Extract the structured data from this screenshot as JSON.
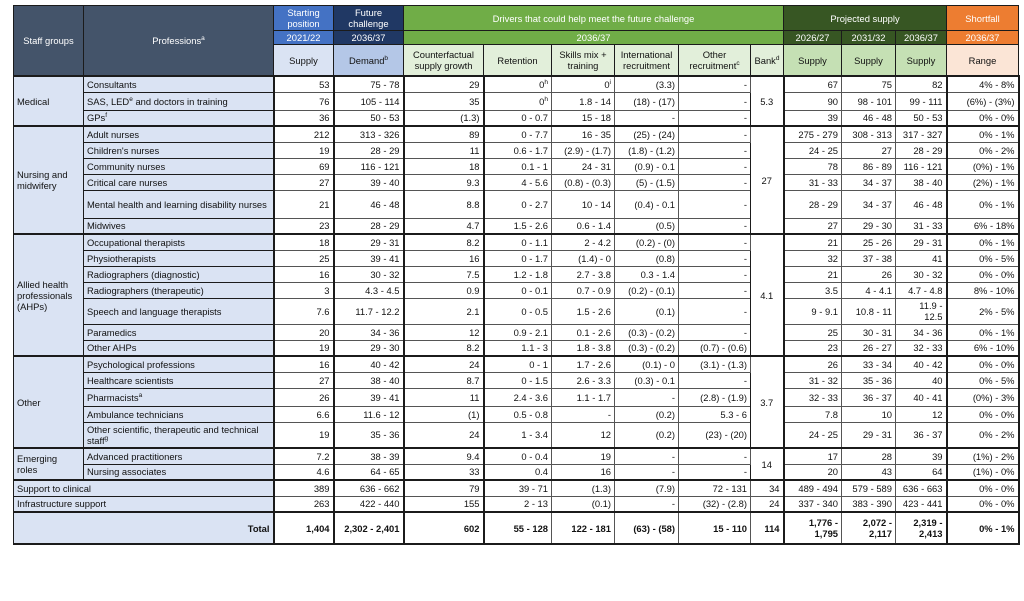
{
  "header": {
    "staff_groups": "Staff groups",
    "professions": "Professions",
    "professions_sup": "a",
    "starting_position": "Starting position",
    "future_challenge": "Future challenge",
    "drivers": "Drivers that could help meet the future challenge",
    "projected_supply": "Projected supply",
    "shortfall": "Shortfall",
    "year_start": "2021/22",
    "year_future": "2036/37",
    "year_drivers": "2036/37",
    "year_p1": "2026/27",
    "year_p2": "2031/32",
    "year_p3": "2036/37",
    "year_shortfall": "2036/37",
    "col_supply": "Supply",
    "col_demand": "Demand",
    "col_demand_sup": "b",
    "col_counterfactual": "Counterfactual supply growth",
    "col_retention": "Retention",
    "col_skills": "Skills mix + training",
    "col_international": "International recruitment",
    "col_other": "Other recruitment",
    "col_other_sup": "c",
    "col_bank": "Bank",
    "col_bank_sup": "d",
    "col_p_supply1": "Supply",
    "col_p_supply2": "Supply",
    "col_p_supply3": "Supply",
    "col_range": "Range"
  },
  "groups": {
    "medical": "Medical",
    "nursing": "Nursing and midwifery",
    "ahp": "Allied health professionals (AHPs)",
    "other": "Other",
    "emerging": "Emerging roles"
  },
  "banks": {
    "medical": "5.3",
    "nursing": "27",
    "ahp": "4.1",
    "other": "3.7",
    "emerging": "14"
  },
  "rows": [
    {
      "profession": "Consultants",
      "sup": "",
      "supply": "53",
      "demand": "75 - 78",
      "counterfactual": "29",
      "retention": "0",
      "retention_sup": "h",
      "skills": "0",
      "skills_sup": "i",
      "international": "(3.3)",
      "other": "-",
      "p1": "67",
      "p2": "75",
      "p3": "82",
      "range": "4% - 8%"
    },
    {
      "profession": "SAS, LED",
      "sup": "e",
      "profession_tail": " and doctors in training",
      "supply": "76",
      "demand": "105 - 114",
      "counterfactual": "35",
      "retention": "0",
      "retention_sup": "h",
      "skills": "1.8 - 14",
      "skills_sup": "",
      "international": "(18) - (17)",
      "other": "-",
      "p1": "90",
      "p2": "98 - 101",
      "p3": "99 - 111",
      "range": "(6%) - (3%)"
    },
    {
      "profession": "GPs",
      "sup": "f",
      "supply": "36",
      "demand": "50 - 53",
      "counterfactual": "(1.3)",
      "retention": "0 - 0.7",
      "retention_sup": "",
      "skills": "15 - 18",
      "skills_sup": "",
      "international": "-",
      "other": "-",
      "p1": "39",
      "p2": "46 - 48",
      "p3": "50 - 53",
      "range": "0% - 0%"
    },
    {
      "profession": "Adult nurses",
      "sup": "",
      "supply": "212",
      "demand": "313 - 326",
      "counterfactual": "89",
      "retention": "0 - 7.7",
      "retention_sup": "",
      "skills": "16 - 35",
      "skills_sup": "",
      "international": "(25) - (24)",
      "other": "-",
      "p1": "275 - 279",
      "p2": "308 - 313",
      "p3": "317 - 327",
      "range": "0% - 1%"
    },
    {
      "profession": "Children's nurses",
      "sup": "",
      "supply": "19",
      "demand": "28 - 29",
      "counterfactual": "11",
      "retention": "0.6 - 1.7",
      "retention_sup": "",
      "skills": "(2.9) - (1.7)",
      "skills_sup": "",
      "international": "(1.8) - (1.2)",
      "other": "-",
      "p1": "24 - 25",
      "p2": "27",
      "p3": "28 - 29",
      "range": "0% - 2%"
    },
    {
      "profession": "Community nurses",
      "sup": "",
      "supply": "69",
      "demand": "116 - 121",
      "counterfactual": "18",
      "retention": "0.1 - 1",
      "retention_sup": "",
      "skills": "24 - 31",
      "skills_sup": "",
      "international": "(0.9) - 0.1",
      "other": "-",
      "p1": "78",
      "p2": "86 - 89",
      "p3": "116 - 121",
      "range": "(0%) - 1%"
    },
    {
      "profession": "Critical care nurses",
      "sup": "",
      "supply": "27",
      "demand": "39 - 40",
      "counterfactual": "9.3",
      "retention": "4 - 5.6",
      "retention_sup": "",
      "skills": "(0.8) - (0.3)",
      "skills_sup": "",
      "international": "(5) - (1.5)",
      "other": "-",
      "p1": "31 - 33",
      "p2": "34 - 37",
      "p3": "38 - 40",
      "range": "(2%) - 1%"
    },
    {
      "profession": "Mental health and learning disability nurses",
      "sup": "",
      "supply": "21",
      "demand": "46 - 48",
      "counterfactual": "8.8",
      "retention": "0 - 2.7",
      "retention_sup": "",
      "skills": "10 - 14",
      "skills_sup": "",
      "international": "(0.4) - 0.1",
      "other": "-",
      "p1": "28 - 29",
      "p2": "34 - 37",
      "p3": "46 - 48",
      "range": "0% - 1%"
    },
    {
      "profession": "Midwives",
      "sup": "",
      "supply": "23",
      "demand": "28 - 29",
      "counterfactual": "4.7",
      "retention": "1.5 - 2.6",
      "retention_sup": "",
      "skills": "0.6 - 1.4",
      "skills_sup": "",
      "international": "(0.5)",
      "other": "-",
      "p1": "27",
      "p2": "29 - 30",
      "p3": "31 - 33",
      "range": "6% - 18%"
    },
    {
      "profession": "Occupational therapists",
      "sup": "",
      "supply": "18",
      "demand": "29 - 31",
      "counterfactual": "8.2",
      "retention": "0 - 1.1",
      "retention_sup": "",
      "skills": "2 - 4.2",
      "skills_sup": "",
      "international": "(0.2) - (0)",
      "other": "-",
      "p1": "21",
      "p2": "25 - 26",
      "p3": "29 - 31",
      "range": "0% - 1%"
    },
    {
      "profession": "Physiotherapists",
      "sup": "",
      "supply": "25",
      "demand": "39 - 41",
      "counterfactual": "16",
      "retention": "0 - 1.7",
      "retention_sup": "",
      "skills": "(1.4) - 0",
      "skills_sup": "",
      "international": "(0.8)",
      "other": "-",
      "p1": "32",
      "p2": "37 - 38",
      "p3": "41",
      "range": "0% - 5%"
    },
    {
      "profession": "Radiographers (diagnostic)",
      "sup": "",
      "supply": "16",
      "demand": "30 - 32",
      "counterfactual": "7.5",
      "retention": "1.2 - 1.8",
      "retention_sup": "",
      "skills": "2.7 - 3.8",
      "skills_sup": "",
      "international": "0.3 - 1.4",
      "other": "-",
      "p1": "21",
      "p2": "26",
      "p3": "30 - 32",
      "range": "0% - 0%"
    },
    {
      "profession": "Radiographers (therapeutic)",
      "sup": "",
      "supply": "3",
      "demand": "4.3 - 4.5",
      "counterfactual": "0.9",
      "retention": "0 - 0.1",
      "retention_sup": "",
      "skills": "0.7 - 0.9",
      "skills_sup": "",
      "international": "(0.2) - (0.1)",
      "other": "-",
      "p1": "3.5",
      "p2": "4 - 4.1",
      "p3": "4.7 - 4.8",
      "range": "8% - 10%"
    },
    {
      "profession": "Speech and language therapists",
      "sup": "",
      "supply": "7.6",
      "demand": "11.7 - 12.2",
      "counterfactual": "2.1",
      "retention": "0 - 0.5",
      "retention_sup": "",
      "skills": "1.5 - 2.6",
      "skills_sup": "",
      "international": "(0.1)",
      "other": "-",
      "p1": "9 - 9.1",
      "p2": "10.8 - 11",
      "p3": "11.9 - 12.5",
      "range": "2% - 5%"
    },
    {
      "profession": "Paramedics",
      "sup": "",
      "supply": "20",
      "demand": "34 - 36",
      "counterfactual": "12",
      "retention": "0.9 - 2.1",
      "retention_sup": "",
      "skills": "0.1 - 2.6",
      "skills_sup": "",
      "international": "(0.3) - (0.2)",
      "other": "-",
      "p1": "25",
      "p2": "30 - 31",
      "p3": "34 - 36",
      "range": "0% - 1%"
    },
    {
      "profession": "Other AHPs",
      "sup": "",
      "supply": "19",
      "demand": "29 - 30",
      "counterfactual": "8.2",
      "retention": "1.1 - 3",
      "retention_sup": "",
      "skills": "1.8 - 3.8",
      "skills_sup": "",
      "international": "(0.3) - (0.2)",
      "other": "(0.7) - (0.6)",
      "p1": "23",
      "p2": "26 - 27",
      "p3": "32 - 33",
      "range": "6% - 10%"
    },
    {
      "profession": "Psychological professions",
      "sup": "",
      "supply": "16",
      "demand": "40 - 42",
      "counterfactual": "24",
      "retention": "0 - 1",
      "retention_sup": "",
      "skills": "1.7 - 2.6",
      "skills_sup": "",
      "international": "(0.1) - 0",
      "other": "(3.1) - (1.3)",
      "p1": "26",
      "p2": "33 - 34",
      "p3": "40 - 42",
      "range": "0% - 0%"
    },
    {
      "profession": "Healthcare scientists",
      "sup": "",
      "supply": "27",
      "demand": "38 - 40",
      "counterfactual": "8.7",
      "retention": "0 - 1.5",
      "retention_sup": "",
      "skills": "2.6 - 3.3",
      "skills_sup": "",
      "international": "(0.3) - 0.1",
      "other": "-",
      "p1": "31 - 32",
      "p2": "35 - 36",
      "p3": "40",
      "range": "0% - 5%"
    },
    {
      "profession": "Pharmacists",
      "sup": "a",
      "supply": "26",
      "demand": "39 - 41",
      "counterfactual": "11",
      "retention": "2.4 - 3.6",
      "retention_sup": "",
      "skills": "1.1 - 1.7",
      "skills_sup": "",
      "international": "-",
      "other": "(2.8) - (1.9)",
      "p1": "32 - 33",
      "p2": "36 - 37",
      "p3": "40 - 41",
      "range": "(0%) - 3%"
    },
    {
      "profession": "Ambulance technicians",
      "sup": "",
      "supply": "6.6",
      "demand": "11.6 - 12",
      "counterfactual": "(1)",
      "retention": "0.5 - 0.8",
      "retention_sup": "",
      "skills": "-",
      "skills_sup": "",
      "international": "(0.2)",
      "other": "5.3 - 6",
      "p1": "7.8",
      "p2": "10",
      "p3": "12",
      "range": "0% - 0%"
    },
    {
      "profession": "Other scientific, therapeutic and technical staff",
      "sup": "g",
      "supply": "19",
      "demand": "35 - 36",
      "counterfactual": "24",
      "retention": "1 - 3.4",
      "retention_sup": "",
      "skills": "12",
      "skills_sup": "",
      "international": "(0.2)",
      "other": "(23) - (20)",
      "p1": "24 - 25",
      "p2": "29 - 31",
      "p3": "36 - 37",
      "range": "0% - 2%"
    },
    {
      "profession": "Advanced practitioners",
      "sup": "",
      "supply": "7.2",
      "demand": "38 - 39",
      "counterfactual": "9.4",
      "retention": "0 - 0.4",
      "retention_sup": "",
      "skills": "19",
      "skills_sup": "",
      "international": "-",
      "other": "-",
      "p1": "17",
      "p2": "28",
      "p3": "39",
      "range": "(1%) - 2%"
    },
    {
      "profession": "Nursing associates",
      "sup": "",
      "supply": "4.6",
      "demand": "64 - 65",
      "counterfactual": "33",
      "retention": "0.4",
      "retention_sup": "",
      "skills": "16",
      "skills_sup": "",
      "international": "-",
      "other": "-",
      "p1": "20",
      "p2": "43",
      "p3": "64",
      "range": "(1%) - 0%"
    }
  ],
  "support_rows": [
    {
      "label": "Support to clinical",
      "supply": "389",
      "demand": "636 - 662",
      "counterfactual": "79",
      "retention": "39 - 71",
      "skills": "(1.3)",
      "international": "(7.9)",
      "other": "72 - 131",
      "bank": "34",
      "p1": "489 - 494",
      "p2": "579 - 589",
      "p3": "636 - 663",
      "range": "0% - 0%"
    },
    {
      "label": "Infrastructure support",
      "supply": "263",
      "demand": "422 - 440",
      "counterfactual": "155",
      "retention": "2 - 13",
      "skills": "(0.1)",
      "international": "-",
      "other": "(32) - (2.8)",
      "bank": "24",
      "p1": "337 - 340",
      "p2": "383 - 390",
      "p3": "423 - 441",
      "range": "0% - 0%"
    }
  ],
  "total": {
    "label": "Total",
    "supply": "1,404",
    "demand": "2,302 - 2,401",
    "counterfactual": "602",
    "retention": "55 - 128",
    "skills": "122 - 181",
    "international": "(63) - (58)",
    "other": "15 - 110",
    "bank": "114",
    "p1": "1,776 - 1,795",
    "p2": "2,072 - 2,117",
    "p3": "2,319 - 2,413",
    "range": "0% - 1%"
  },
  "colors": {
    "header_dark": "#44546a",
    "header_blue": "#4472c4",
    "header_navy": "#203864",
    "header_green": "#70ad47",
    "header_dark_green": "#375623",
    "header_orange": "#ed7d31",
    "row_label_bg": "#dae3f3"
  }
}
